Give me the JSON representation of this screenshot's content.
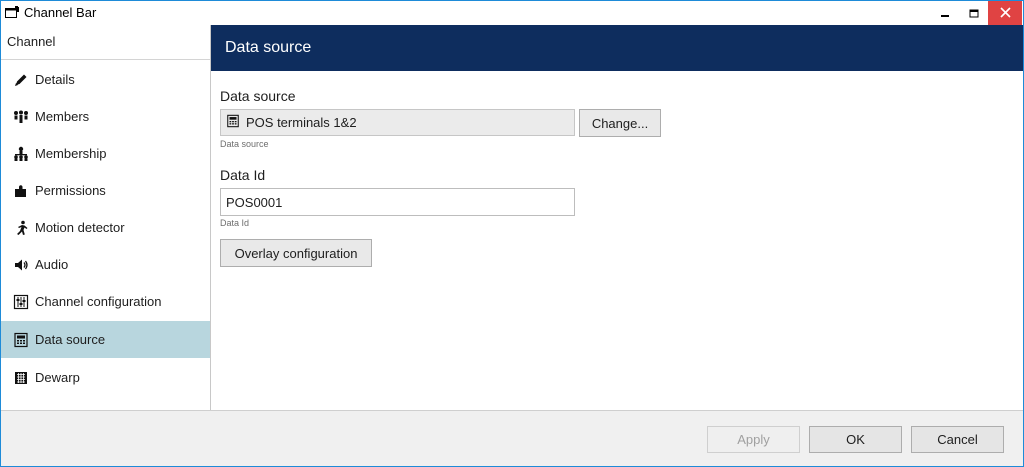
{
  "window": {
    "title": "Channel Bar",
    "app_icon": "channel-bar-app-icon",
    "controls": {
      "minimize": "minimize-icon",
      "maximize": "maximize-icon",
      "close": "close-icon"
    }
  },
  "sidebar": {
    "header": "Channel",
    "items": [
      {
        "label": "Details",
        "icon": "pencil-icon"
      },
      {
        "label": "Members",
        "icon": "members-icon"
      },
      {
        "label": "Membership",
        "icon": "hierarchy-icon"
      },
      {
        "label": "Permissions",
        "icon": "puzzle-icon"
      },
      {
        "label": "Motion detector",
        "icon": "running-man-icon"
      },
      {
        "label": "Audio",
        "icon": "speaker-icon"
      },
      {
        "label": "Channel configuration",
        "icon": "sliders-icon"
      },
      {
        "label": "Data source",
        "icon": "data-source-icon",
        "active": true
      },
      {
        "label": "Dewarp",
        "icon": "dewarp-icon"
      }
    ]
  },
  "main": {
    "header": "Data source",
    "data_source": {
      "label": "Data source",
      "value": "POS terminals 1&2",
      "hint": "Data source",
      "change_button": "Change..."
    },
    "data_id": {
      "label": "Data Id",
      "value": "POS0001",
      "hint": "Data Id"
    },
    "overlay_button": "Overlay configuration"
  },
  "footer": {
    "apply": "Apply",
    "ok": "OK",
    "cancel": "Cancel"
  },
  "colors": {
    "header_bg": "#0e2d5e",
    "active_item_bg": "#b8d6de",
    "close_button_bg": "#e04343",
    "window_border": "#1e8bd8"
  }
}
